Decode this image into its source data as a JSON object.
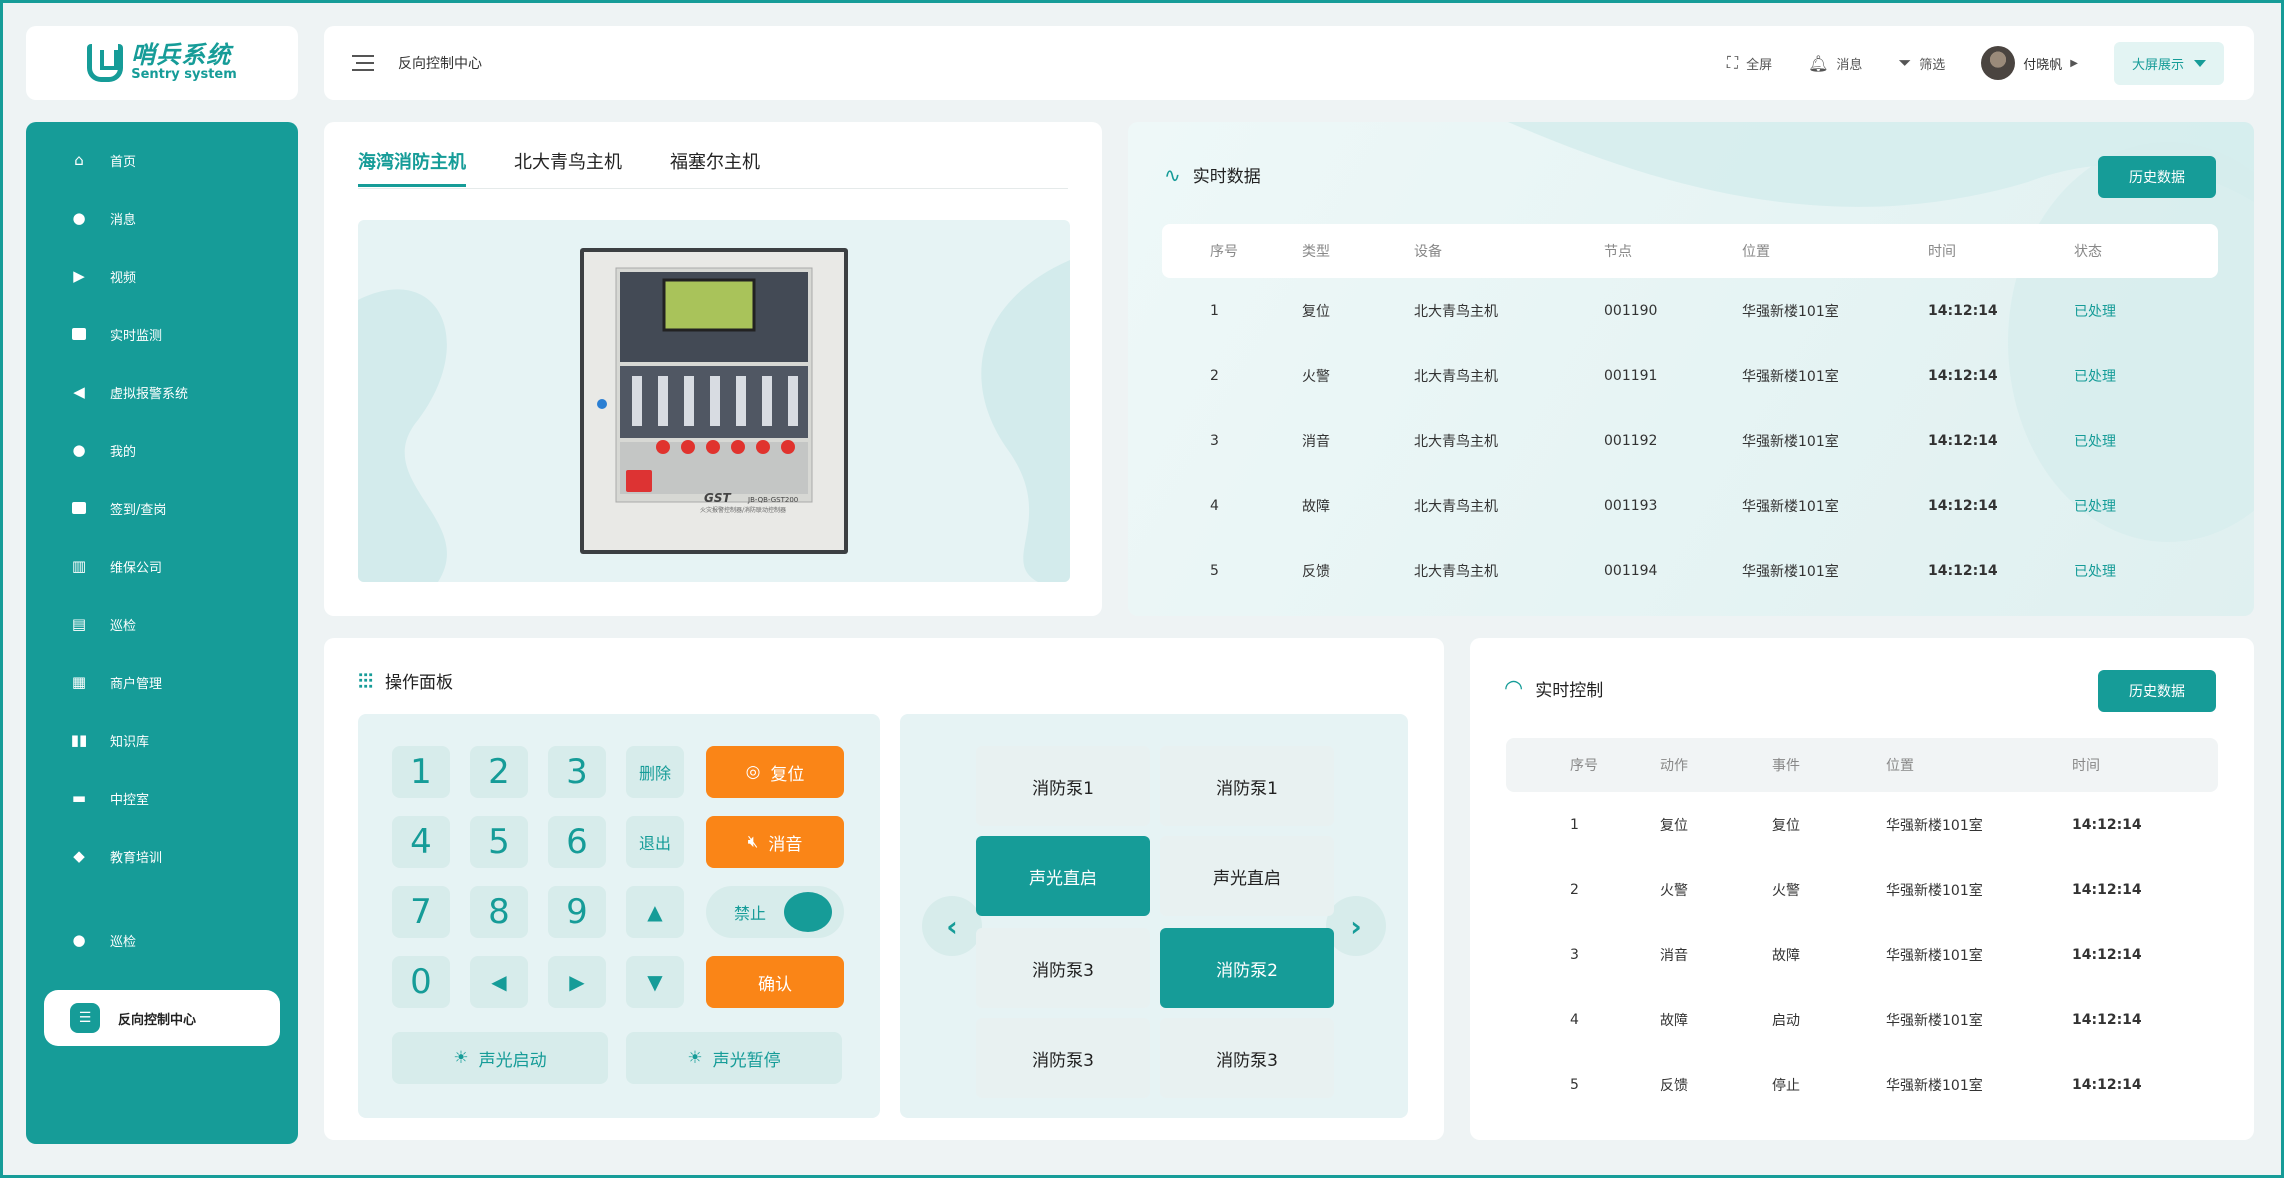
{
  "logo": {
    "cn": "哨兵系统",
    "en": "Sentry system"
  },
  "topbar": {
    "breadcrumb": "反向控制中心",
    "fullscreen": "全屏",
    "messages": "消息",
    "filter": "筛选",
    "user": "付晓帆",
    "big_screen": "大屏展示"
  },
  "sidebar": {
    "items": [
      {
        "label": "首页",
        "icon": "home-icon"
      },
      {
        "label": "消息",
        "icon": "bell-icon"
      },
      {
        "label": "视频",
        "icon": "video-icon"
      },
      {
        "label": "实时监测",
        "icon": "monitor-icon"
      },
      {
        "label": "虚拟报警系统",
        "icon": "speaker-icon"
      },
      {
        "label": "我的",
        "icon": "user-icon"
      },
      {
        "label": "签到/查岗",
        "icon": "checkin-icon"
      },
      {
        "label": "维保公司",
        "icon": "building-icon"
      },
      {
        "label": "巡检",
        "icon": "clipboard-icon"
      },
      {
        "label": "商户管理",
        "icon": "grid-icon"
      },
      {
        "label": "知识库",
        "icon": "book-icon"
      },
      {
        "label": "中控室",
        "icon": "console-icon"
      },
      {
        "label": "教育培训",
        "icon": "graduation-icon"
      },
      {
        "label": "巡检",
        "icon": "inspector-icon"
      }
    ],
    "active": "反向控制中心"
  },
  "host_tabs": [
    "海湾消防主机",
    "北大青鸟主机",
    "福塞尔主机"
  ],
  "device_image": {
    "brand": "GST",
    "model": "JB-QB-GST200",
    "caption": "火灾报警控制器/消防联动控制器"
  },
  "realtime_data": {
    "title": "实时数据",
    "history_btn": "历史数据",
    "headers": [
      "序号",
      "类型",
      "设备",
      "节点",
      "位置",
      "时间",
      "状态"
    ],
    "rows": [
      [
        "1",
        "复位",
        "北大青鸟主机",
        "001190",
        "华强新楼101室",
        "14:12:14",
        "已处理"
      ],
      [
        "2",
        "火警",
        "北大青鸟主机",
        "001191",
        "华强新楼101室",
        "14:12:14",
        "已处理"
      ],
      [
        "3",
        "消音",
        "北大青鸟主机",
        "001192",
        "华强新楼101室",
        "14:12:14",
        "已处理"
      ],
      [
        "4",
        "故障",
        "北大青鸟主机",
        "001193",
        "华强新楼101室",
        "14:12:14",
        "已处理"
      ],
      [
        "5",
        "反馈",
        "北大青鸟主机",
        "001194",
        "华强新楼101室",
        "14:12:14",
        "已处理"
      ]
    ]
  },
  "operation_panel": {
    "title": "操作面板",
    "digits": [
      "1",
      "2",
      "3",
      "4",
      "5",
      "6",
      "7",
      "8",
      "9",
      "0"
    ],
    "delete": "删除",
    "exit": "退出",
    "reset": "复位",
    "mute": "消音",
    "disable": "禁止",
    "confirm": "确认",
    "light_start": "声光启动",
    "light_pause": "声光暂停"
  },
  "pumps": [
    "消防泵1",
    "消防泵1",
    "声光直启",
    "声光直启",
    "消防泵3",
    "消防泵2",
    "消防泵3",
    "消防泵3"
  ],
  "realtime_control": {
    "title": "实时控制",
    "history_btn": "历史数据",
    "headers": [
      "序号",
      "动作",
      "事件",
      "位置",
      "时间"
    ],
    "rows": [
      [
        "1",
        "复位",
        "复位",
        "华强新楼101室",
        "14:12:14"
      ],
      [
        "2",
        "火警",
        "火警",
        "华强新楼101室",
        "14:12:14"
      ],
      [
        "3",
        "消音",
        "故障",
        "华强新楼101室",
        "14:12:14"
      ],
      [
        "4",
        "故障",
        "启动",
        "华强新楼101室",
        "14:12:14"
      ],
      [
        "5",
        "反馈",
        "停止",
        "华强新楼101室",
        "14:12:14"
      ]
    ]
  },
  "colors": {
    "primary": "#169c98",
    "orange": "#fa8517",
    "light": "#e6f3f4"
  }
}
